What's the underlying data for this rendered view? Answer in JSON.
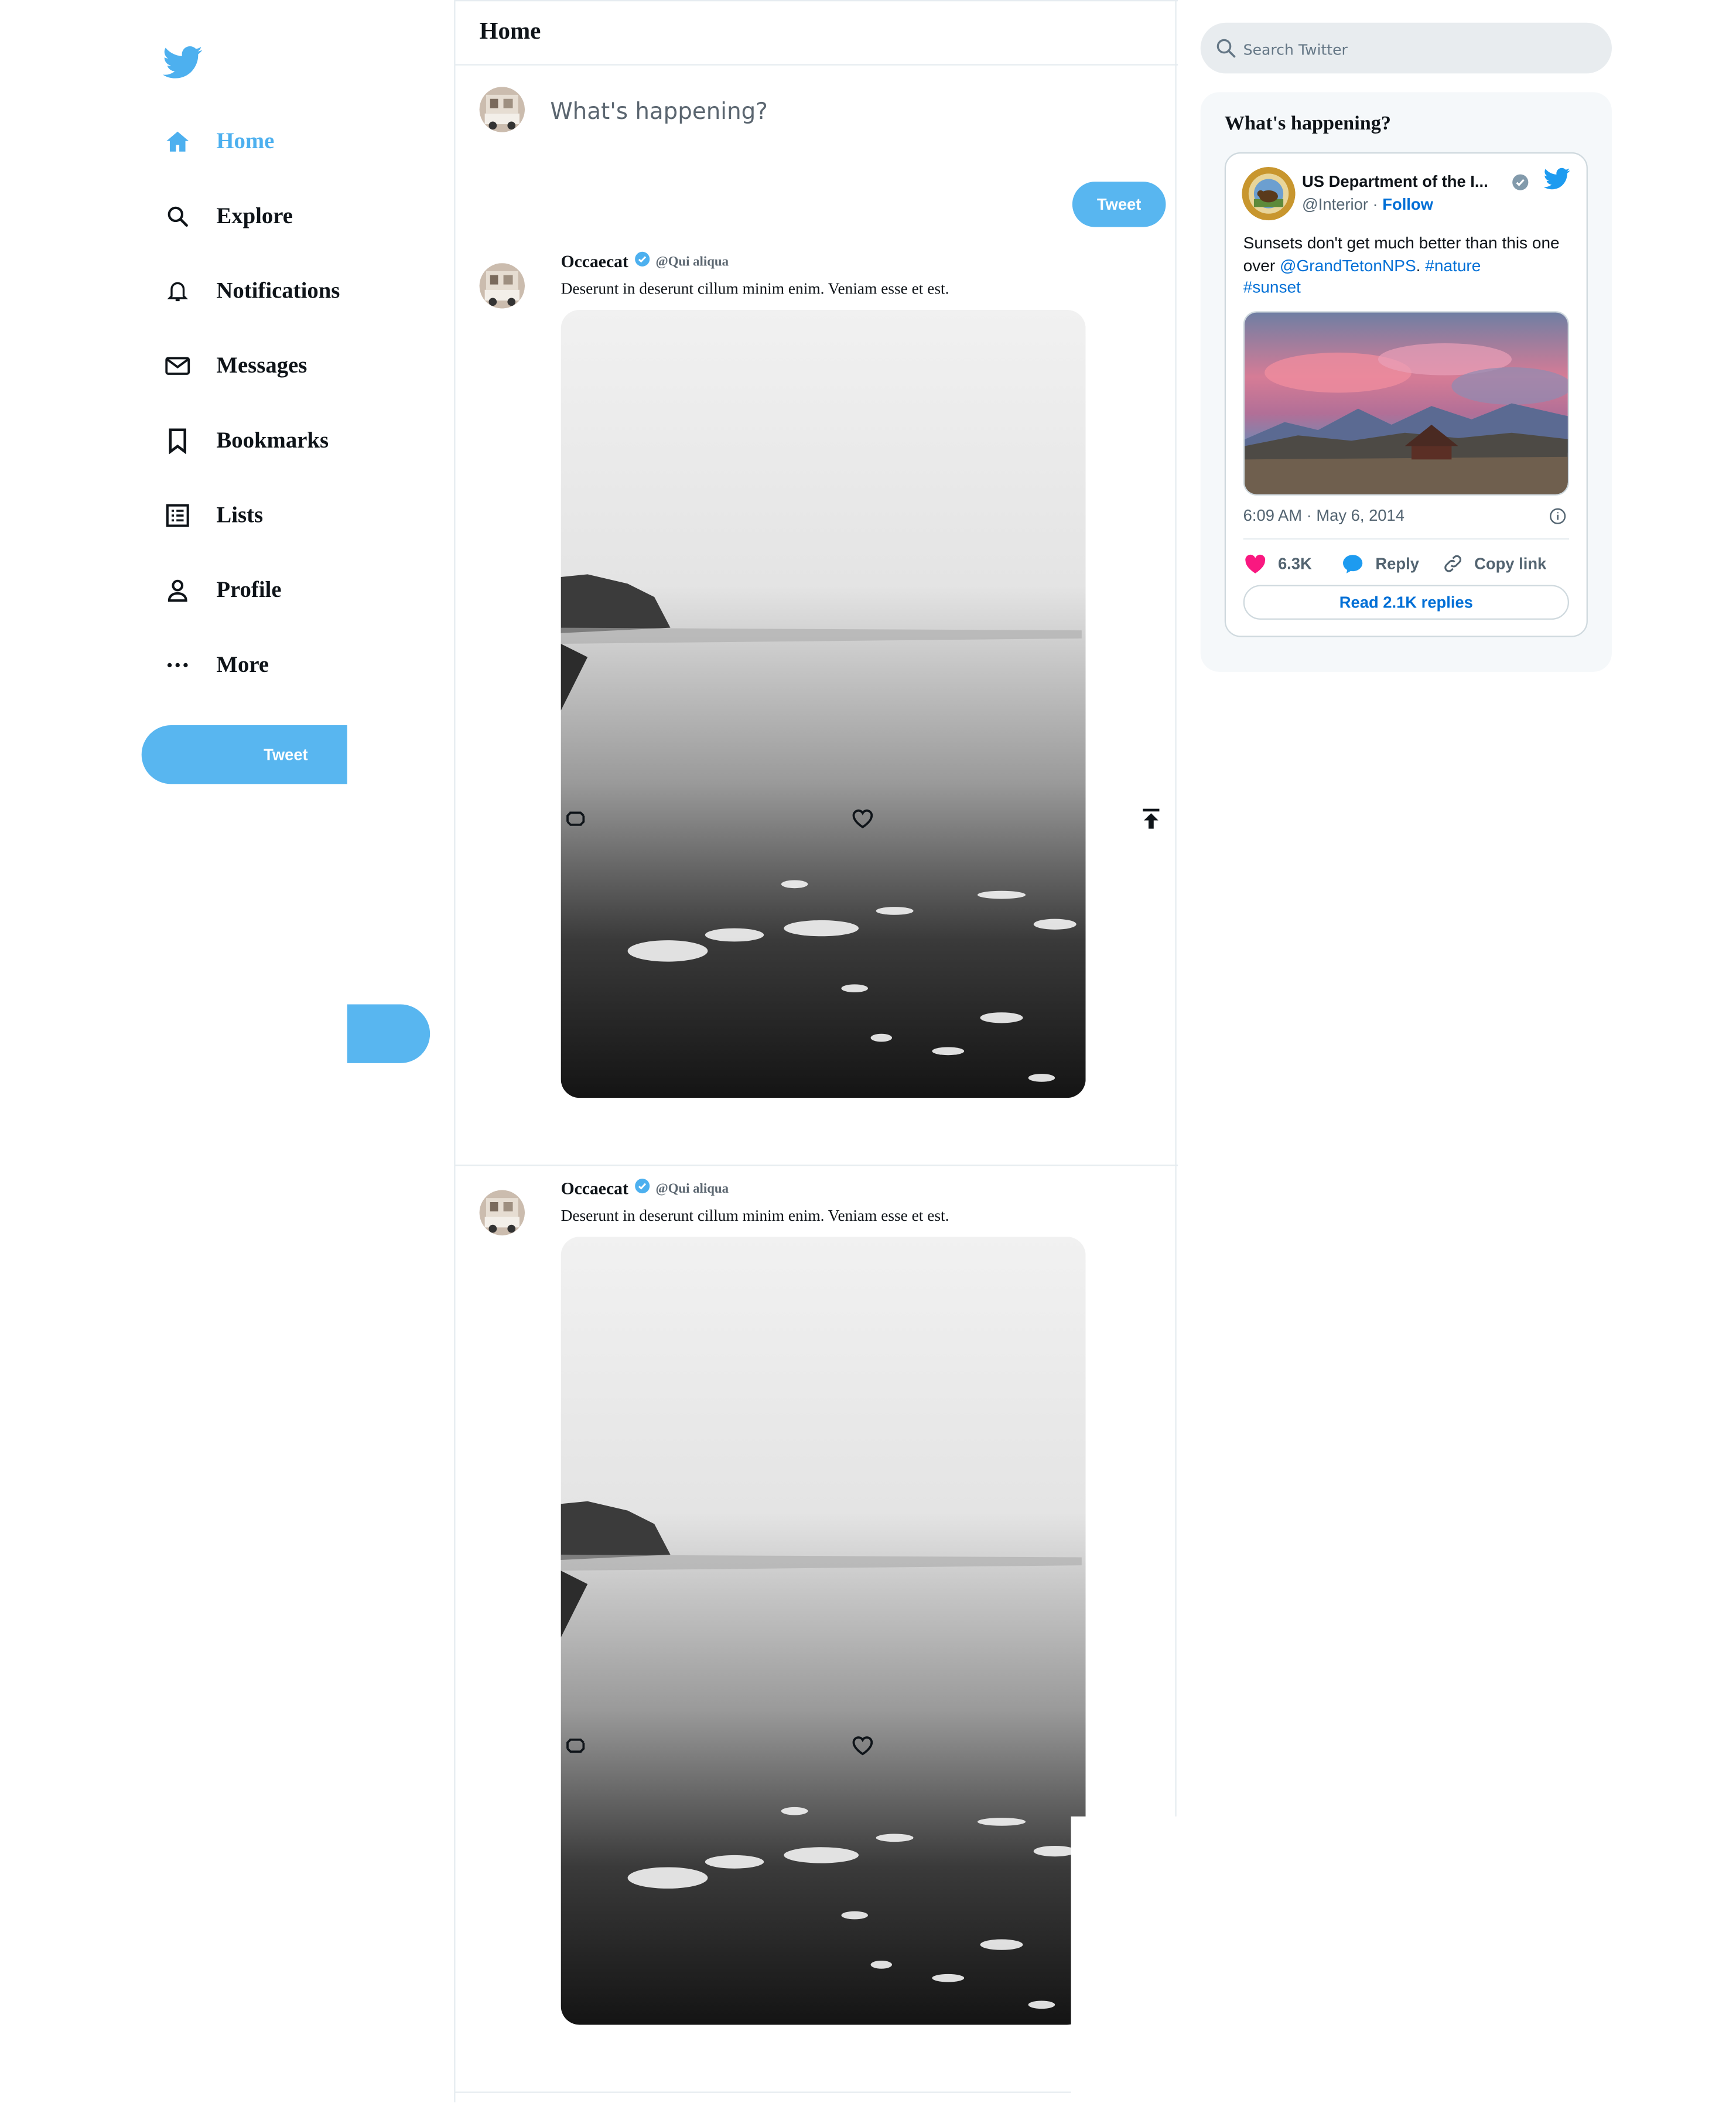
{
  "sidebar": {
    "logo_icon": "twitter-bird-icon",
    "nav": [
      {
        "label": "Home",
        "icon": "home-icon",
        "active": true
      },
      {
        "label": "Explore",
        "icon": "search-icon"
      },
      {
        "label": "Notifications",
        "icon": "bell-icon"
      },
      {
        "label": "Messages",
        "icon": "envelope-icon"
      },
      {
        "label": "Bookmarks",
        "icon": "bookmark-icon"
      },
      {
        "label": "Lists",
        "icon": "list-icon"
      },
      {
        "label": "Profile",
        "icon": "person-icon"
      },
      {
        "label": "More",
        "icon": "more-icon"
      }
    ],
    "tweet_button": "Tweet"
  },
  "main": {
    "header_title": "Home",
    "compose": {
      "placeholder": "What's happening?",
      "button": "Tweet"
    },
    "tweets": [
      {
        "name": "Occaecat",
        "handle": "@Qui aliqua",
        "verified": true,
        "text": "Deserunt in deserunt cillum minim enim. Veniam esse et est.",
        "photo": "black-and-white-beach"
      },
      {
        "name": "Occaecat",
        "handle": "@Qui aliqua",
        "verified": true,
        "text": "Deserunt in deserunt cillum minim enim. Veniam esse et est.",
        "photo": "black-and-white-beach"
      }
    ]
  },
  "right": {
    "search_placeholder": "Search Twitter",
    "panel_title": "What's happening?",
    "embed": {
      "name": "US Department of the I...",
      "handle": "@Interior",
      "handle_sep": " · ",
      "follow": "Follow",
      "text_before": "Sunsets don't get much better than this one over ",
      "mention": "@GrandTetonNPS",
      "text_mid": ". ",
      "hashtag1": "#nature",
      "hashtag2": "#sunset",
      "time": "6:09 AM · May 6, 2014",
      "likes": "6.3K",
      "reply": "Reply",
      "copy_link": "Copy link",
      "read_replies": "Read 2.1K replies"
    }
  },
  "colors": {
    "accent": "#58b6f0",
    "active_text": "#4db0ef",
    "link": "#006fd6",
    "like": "#f91880"
  }
}
